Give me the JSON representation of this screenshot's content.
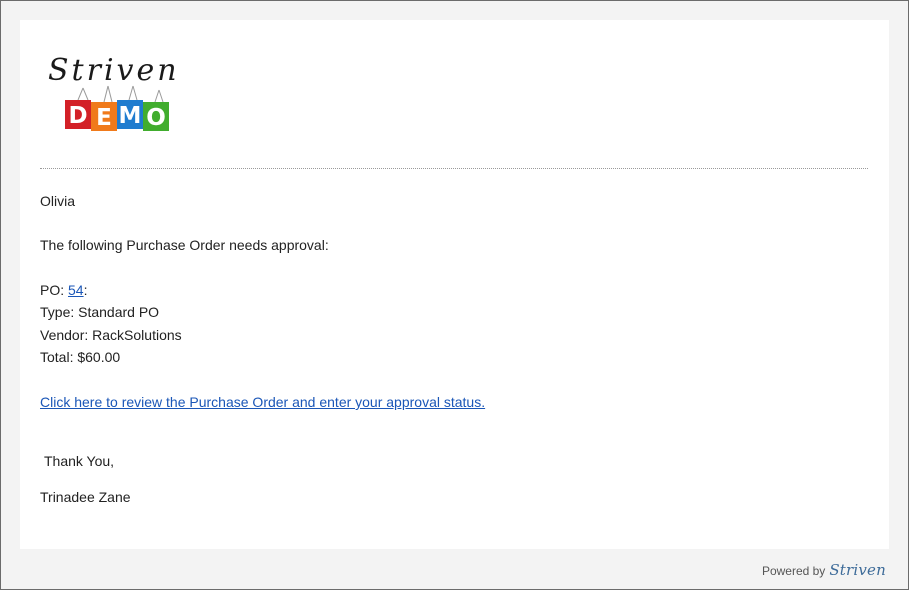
{
  "logo": {
    "script_text": "Striven",
    "letters": [
      "D",
      "E",
      "M",
      "O"
    ],
    "colors": [
      "#d32027",
      "#f07a1b",
      "#1f7ccf",
      "#41ad2e"
    ]
  },
  "email": {
    "greeting": "Olivia",
    "intro": "The following Purchase Order needs approval:",
    "po_label": "PO: ",
    "po_number": "54",
    "po_suffix": ":",
    "type_line": "Type: Standard PO",
    "vendor_line": "Vendor: RackSolutions",
    "total_line": "Total: $60.00",
    "review_link": "Click here to review the Purchase Order and enter your approval status.",
    "thanks": "Thank You,",
    "signature": "Trinadee Zane"
  },
  "footer": {
    "powered_by": "Powered by",
    "brand": "Striven"
  },
  "theme": {
    "link_color": "#1a56b7",
    "frame_bg": "#f3f3f3"
  }
}
